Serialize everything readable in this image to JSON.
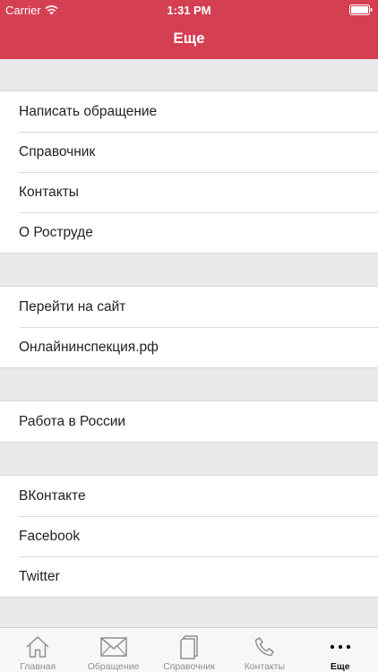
{
  "status_bar": {
    "carrier": "Carrier",
    "time": "1:31 PM"
  },
  "navigation": {
    "title": "Еще"
  },
  "sections": [
    {
      "items": [
        "Написать обращение",
        "Справочник",
        "Контакты",
        "О Роструде"
      ]
    },
    {
      "items": [
        "Перейти на сайт",
        "Онлайнинспекция.рф"
      ]
    },
    {
      "items": [
        "Работа в России"
      ]
    },
    {
      "items": [
        "ВКонтакте",
        "Facebook",
        "Twitter"
      ]
    }
  ],
  "tabbar": {
    "tabs": [
      {
        "label": "Главная",
        "icon": "home-icon"
      },
      {
        "label": "Обращение",
        "icon": "envelope-icon"
      },
      {
        "label": "Справочник",
        "icon": "book-icon"
      },
      {
        "label": "Контакты",
        "icon": "phone-icon"
      },
      {
        "label": "Еще",
        "icon": "more-dots-icon",
        "active": true
      }
    ]
  },
  "colors": {
    "accent": "#d43f51",
    "background": "#e9eaeb"
  }
}
